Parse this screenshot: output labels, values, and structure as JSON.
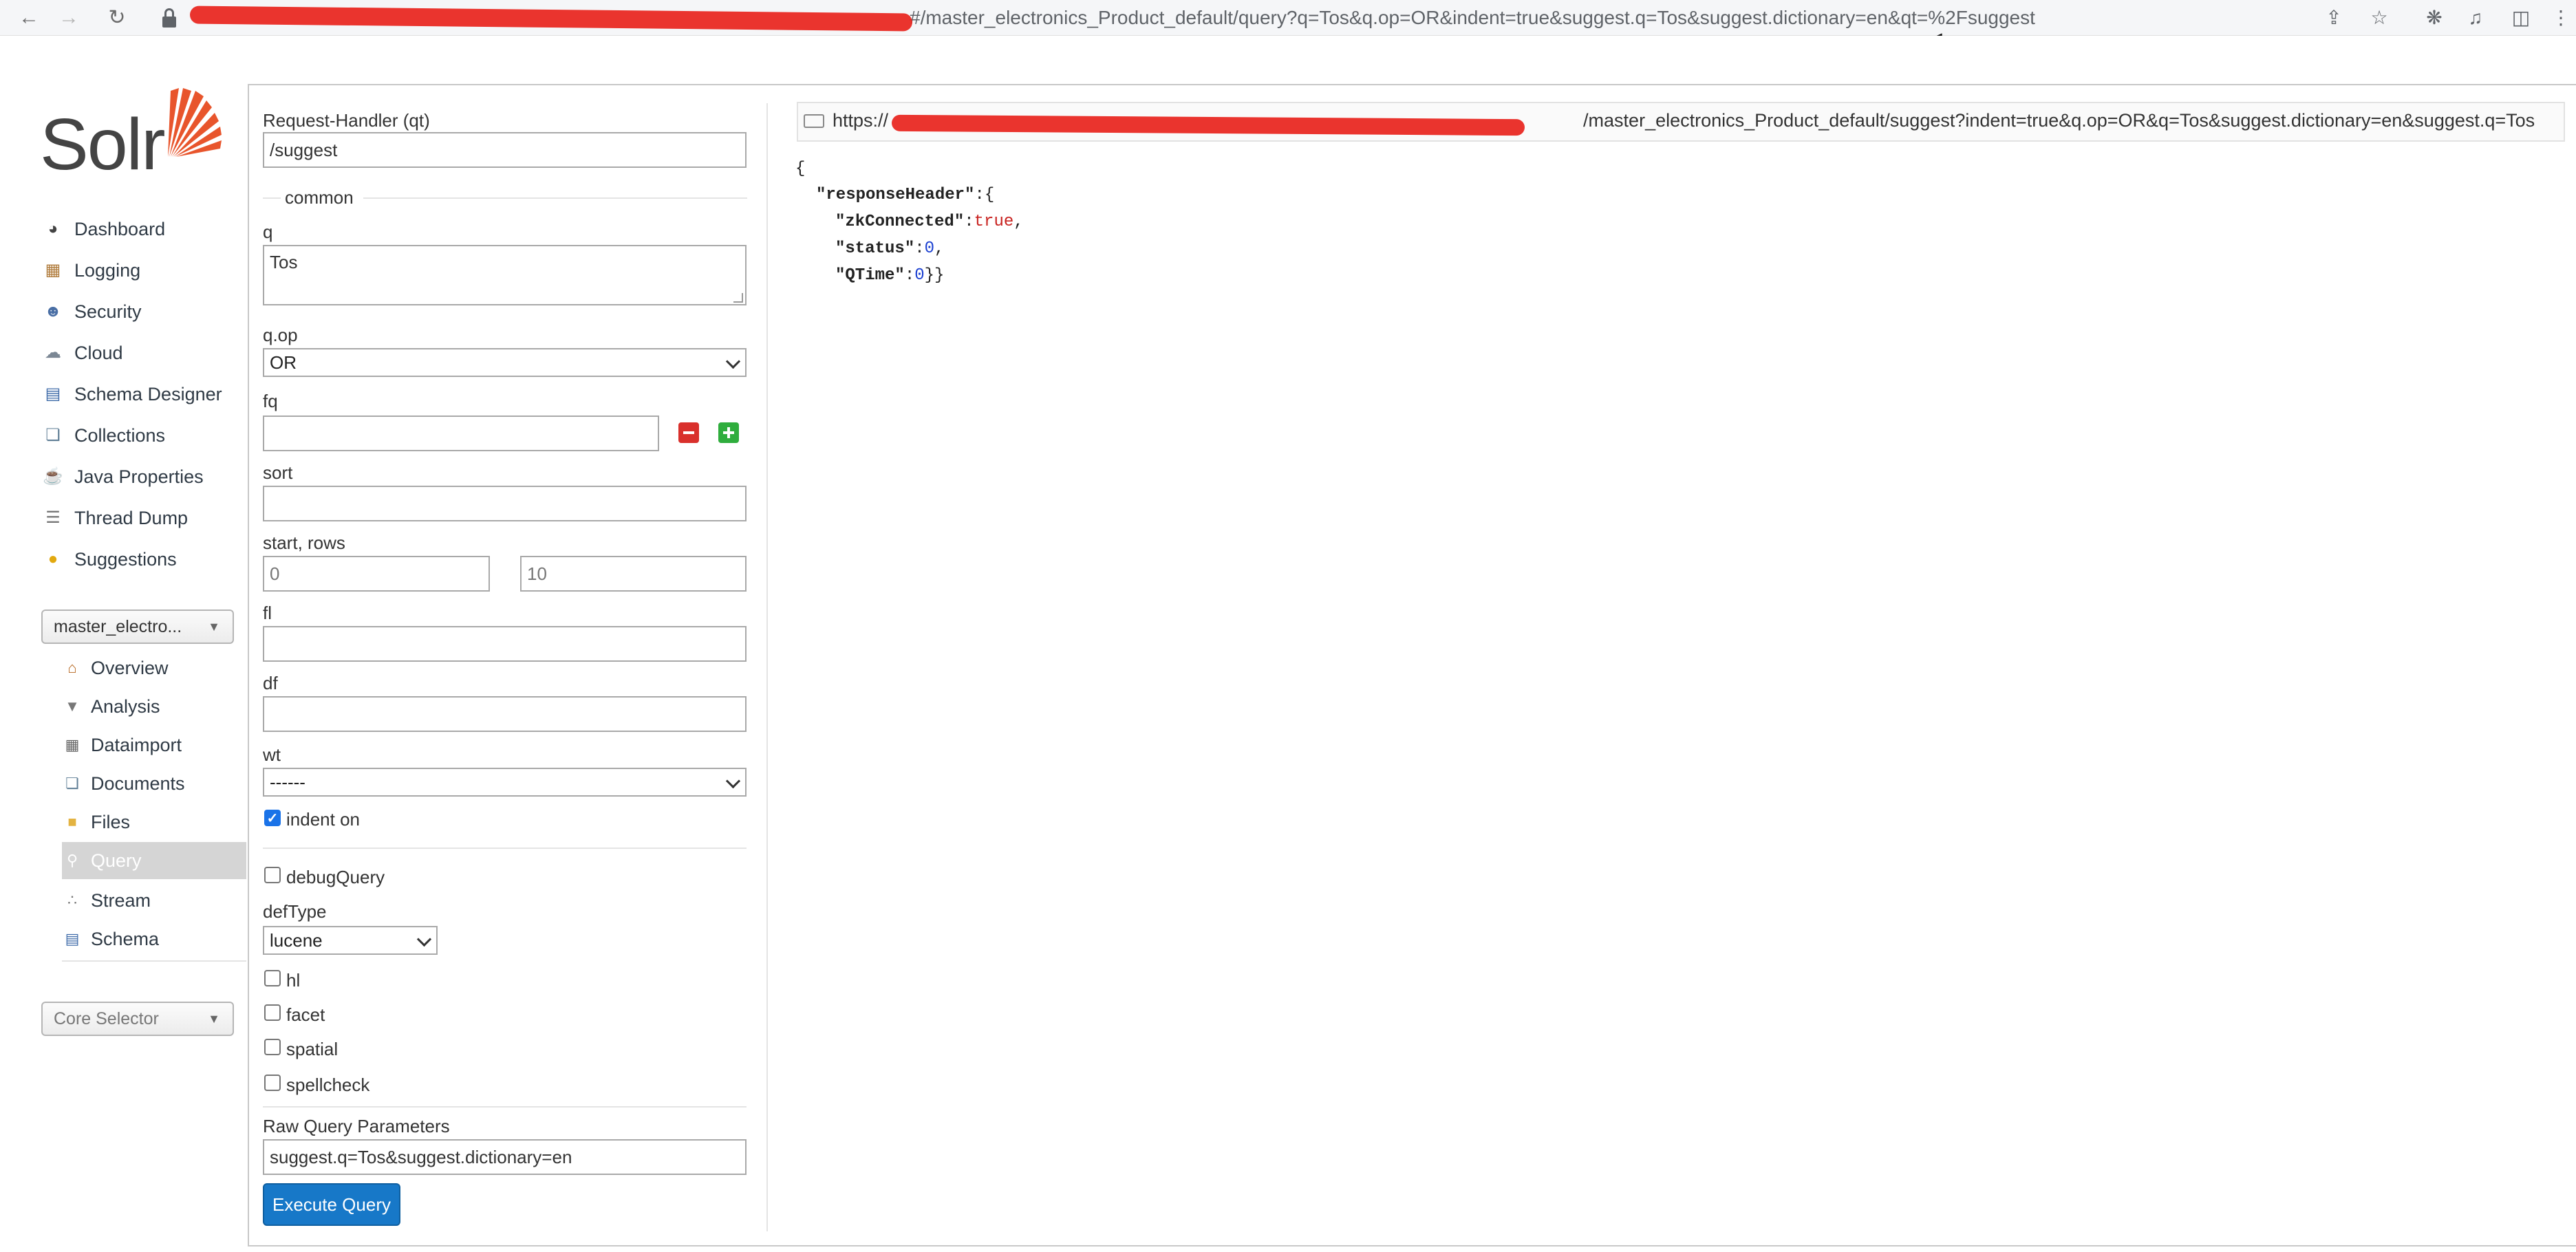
{
  "browser": {
    "url_suffix": "#/master_electronics_Product_default/query?q=Tos&q.op=OR&indent=true&suggest.q=Tos&suggest.dictionary=en&qt=%2Fsuggest"
  },
  "logo": {
    "text": "Solr"
  },
  "nav": {
    "items": [
      {
        "label": "Dashboard"
      },
      {
        "label": "Logging"
      },
      {
        "label": "Security"
      },
      {
        "label": "Cloud"
      },
      {
        "label": "Schema Designer"
      },
      {
        "label": "Collections"
      },
      {
        "label": "Java Properties"
      },
      {
        "label": "Thread Dump"
      },
      {
        "label": "Suggestions"
      }
    ],
    "collection_selector": "master_electro...",
    "core_items": [
      {
        "label": "Overview"
      },
      {
        "label": "Analysis"
      },
      {
        "label": "Dataimport"
      },
      {
        "label": "Documents"
      },
      {
        "label": "Files"
      },
      {
        "label": "Query"
      },
      {
        "label": "Stream"
      },
      {
        "label": "Schema"
      }
    ],
    "core_selector": "Core Selector"
  },
  "form": {
    "request_handler_label": "Request-Handler (qt)",
    "request_handler_value": "/suggest",
    "common_legend": "common",
    "q_label": "q",
    "q_value": "Tos",
    "qop_label": "q.op",
    "qop_value": "OR",
    "fq_label": "fq",
    "sort_label": "sort",
    "start_rows_label": "start, rows",
    "start_placeholder": "0",
    "rows_placeholder": "10",
    "fl_label": "fl",
    "df_label": "df",
    "wt_label": "wt",
    "wt_value": "------",
    "indent_label": "indent on",
    "debug_label": "debugQuery",
    "deftype_label": "defType",
    "deftype_value": "lucene",
    "hl_label": "hl",
    "facet_label": "facet",
    "spatial_label": "spatial",
    "spellcheck_label": "spellcheck",
    "raw_label": "Raw Query Parameters",
    "raw_value": "suggest.q=Tos&suggest.dictionary=en",
    "execute_label": "Execute Query"
  },
  "result": {
    "url_prefix": "https://",
    "url_suffix": "/master_electronics_Product_default/suggest?indent=true&q.op=OR&q=Tos&suggest.dictionary=en&suggest.q=Tos",
    "json": {
      "open_brace": "{",
      "response_header_key": "\"responseHeader\"",
      "response_header_tail": ":{",
      "zk_key": "\"zkConnected\"",
      "zk_value": "true",
      "status_key": "\"status\"",
      "status_value": "0",
      "qtime_key": "\"QTime\"",
      "qtime_value": "0",
      "close": "}}"
    }
  }
}
